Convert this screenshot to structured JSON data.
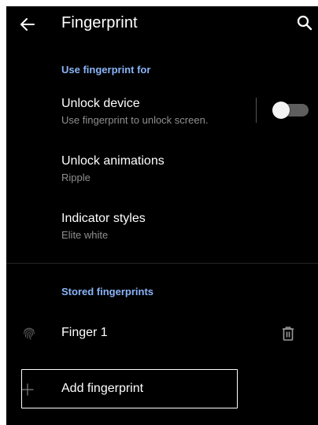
{
  "appbar": {
    "title": "Fingerprint",
    "back_icon": "arrow-left-icon",
    "search_icon": "search-icon"
  },
  "sections": {
    "use_for_header": "Use fingerprint for",
    "stored_header": "Stored fingerprints"
  },
  "settings": {
    "unlock_device": {
      "title": "Unlock device",
      "subtitle": "Use fingerprint to unlock screen.",
      "toggle_on": false
    },
    "unlock_animations": {
      "title": "Unlock animations",
      "subtitle": "Ripple"
    },
    "indicator_styles": {
      "title": "Indicator styles",
      "subtitle": "Elite white"
    }
  },
  "fingerprints": [
    {
      "name": "Finger 1",
      "icon": "fingerprint-icon",
      "action_icon": "trash-icon"
    }
  ],
  "add_fingerprint": {
    "label": "Add fingerprint",
    "icon": "plus-icon"
  },
  "colors": {
    "background": "#000000",
    "accent": "#8ab4f8",
    "text_primary": "#ffffff",
    "text_secondary": "#8f8f8f",
    "toggle_track_off": "#5e5e5e"
  }
}
